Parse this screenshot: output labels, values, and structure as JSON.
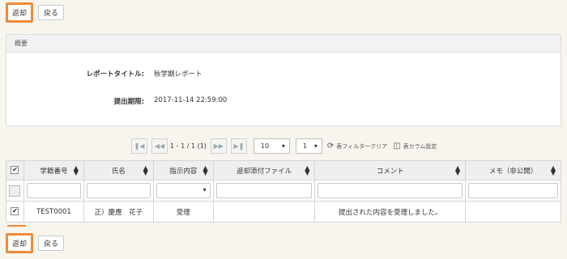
{
  "top_actions": {
    "return_label": "返却",
    "back_label": "戻る"
  },
  "summary": {
    "header": "概要",
    "title_label": "レポートタイトル:",
    "title_value": "秋学期レポート",
    "deadline_label": "提出期限:",
    "deadline_value": "2017-11-14 22:59:00"
  },
  "pager": {
    "range": "1 - 1 / 1 (1)",
    "page_size": "10",
    "page": "1",
    "filter_clear": "表フィルタークリア",
    "column_settings": "表カラム設定"
  },
  "table": {
    "columns": [
      "学籍番号",
      "氏名",
      "指示内容",
      "返却添付ファイル",
      "コメント",
      "メモ（非公開）"
    ],
    "rows": [
      {
        "student_id": "TEST0001",
        "name": "正）慶應　花子",
        "instruction": "受理",
        "attachment": "",
        "comment": "提出された内容を受理しました。",
        "memo": ""
      }
    ]
  },
  "bottom_actions": {
    "return_label": "返却",
    "back_label": "戻る"
  },
  "colors": {
    "accent": "#f08a34",
    "header_bg": "#efefef",
    "page_bg": "#f7f5ee"
  }
}
